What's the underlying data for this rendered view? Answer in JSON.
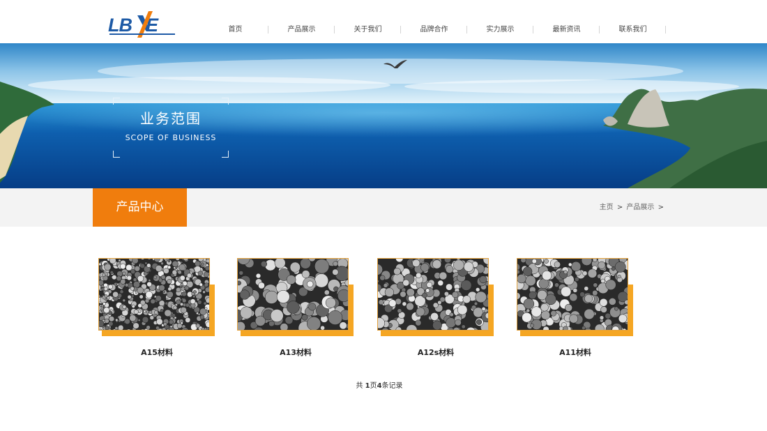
{
  "header": {
    "logo_text": "LBNE",
    "colors": {
      "logo_blue": "#1d5aa6",
      "logo_orange": "#f07d0d"
    },
    "nav": [
      {
        "label": "首页"
      },
      {
        "label": "产品展示"
      },
      {
        "label": "关于我们"
      },
      {
        "label": "品牌合作"
      },
      {
        "label": "实力展示"
      },
      {
        "label": "最新资讯"
      },
      {
        "label": "联系我们"
      }
    ]
  },
  "banner": {
    "title_cn": "业务范围",
    "title_en": "SCOPE OF BUSINESS",
    "image": "seascape-with-cliffs-and-bird"
  },
  "section": {
    "title": "产品中心",
    "accent_color": "#f07d0d",
    "breadcrumb": [
      {
        "label": "主页"
      },
      {
        "label": "产品展示"
      }
    ],
    "breadcrumb_separator": ">"
  },
  "products": [
    {
      "name": "A15材料",
      "image": "sem-powder-fine"
    },
    {
      "name": "A13材料",
      "image": "sem-powder-coarse"
    },
    {
      "name": "A12s材料",
      "image": "sem-powder-medium"
    },
    {
      "name": "A11材料",
      "image": "sem-powder-medium"
    }
  ],
  "pager": {
    "prefix": "共",
    "pages": "1",
    "pages_unit": "页",
    "records": "4",
    "records_unit": "条记录"
  }
}
